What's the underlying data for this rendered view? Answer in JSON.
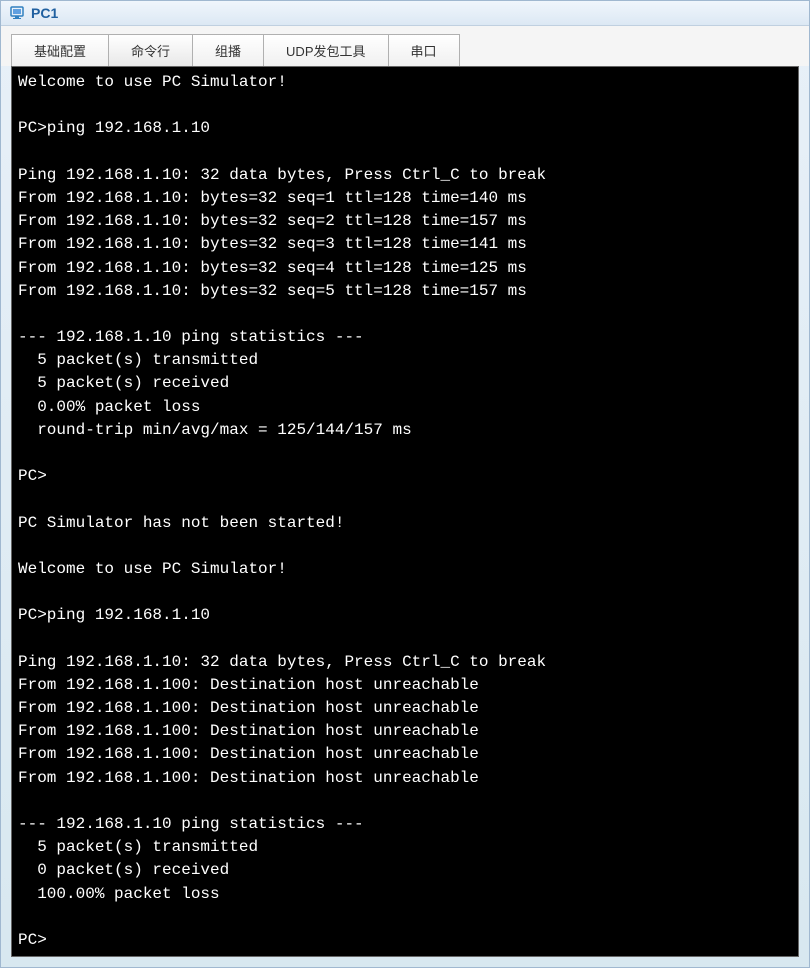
{
  "window": {
    "title": "PC1"
  },
  "tabs": {
    "items": [
      {
        "label": "基础配置"
      },
      {
        "label": "命令行"
      },
      {
        "label": "组播"
      },
      {
        "label": "UDP发包工具"
      },
      {
        "label": "串口"
      }
    ],
    "activeIndex": 1
  },
  "terminal": {
    "lines": [
      "Welcome to use PC Simulator!",
      "",
      "PC>ping 192.168.1.10",
      "",
      "Ping 192.168.1.10: 32 data bytes, Press Ctrl_C to break",
      "From 192.168.1.10: bytes=32 seq=1 ttl=128 time=140 ms",
      "From 192.168.1.10: bytes=32 seq=2 ttl=128 time=157 ms",
      "From 192.168.1.10: bytes=32 seq=3 ttl=128 time=141 ms",
      "From 192.168.1.10: bytes=32 seq=4 ttl=128 time=125 ms",
      "From 192.168.1.10: bytes=32 seq=5 ttl=128 time=157 ms",
      "",
      "--- 192.168.1.10 ping statistics ---",
      "  5 packet(s) transmitted",
      "  5 packet(s) received",
      "  0.00% packet loss",
      "  round-trip min/avg/max = 125/144/157 ms",
      "",
      "PC>",
      "",
      "PC Simulator has not been started!",
      "",
      "Welcome to use PC Simulator!",
      "",
      "PC>ping 192.168.1.10",
      "",
      "Ping 192.168.1.10: 32 data bytes, Press Ctrl_C to break",
      "From 192.168.1.100: Destination host unreachable",
      "From 192.168.1.100: Destination host unreachable",
      "From 192.168.1.100: Destination host unreachable",
      "From 192.168.1.100: Destination host unreachable",
      "From 192.168.1.100: Destination host unreachable",
      "",
      "--- 192.168.1.10 ping statistics ---",
      "  5 packet(s) transmitted",
      "  0 packet(s) received",
      "  100.00% packet loss",
      "",
      "PC>"
    ]
  }
}
